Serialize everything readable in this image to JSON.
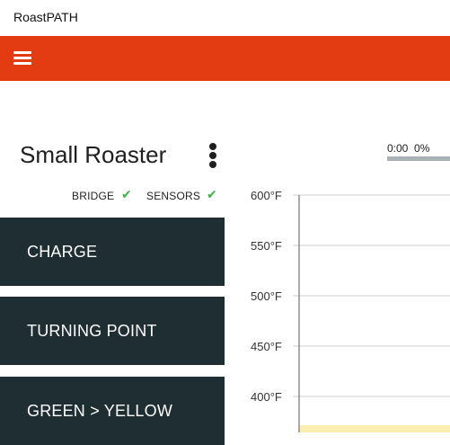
{
  "app": {
    "title": "RoastPATH"
  },
  "colors": {
    "topbar": "#e33c12",
    "button_bg": "#1f2e33",
    "check": "#43b049",
    "highlight": "#fbeeb0"
  },
  "roaster": {
    "name": "Small Roaster"
  },
  "status": [
    {
      "label": "BRIDGE",
      "ok": true
    },
    {
      "label": "SENSORS",
      "ok": true
    }
  ],
  "events": [
    {
      "label": "CHARGE"
    },
    {
      "label": "TURNING POINT"
    },
    {
      "label": "GREEN > YELLOW"
    }
  ],
  "roast": {
    "time": "0:00",
    "percent": "0%",
    "progress": 0
  },
  "chart_data": {
    "type": "line",
    "y_unit": "°F",
    "y_ticks": [
      "600°F",
      "550°F",
      "500°F",
      "450°F",
      "400°F"
    ],
    "y_tick_values": [
      600,
      550,
      500,
      450,
      400
    ],
    "series": []
  }
}
